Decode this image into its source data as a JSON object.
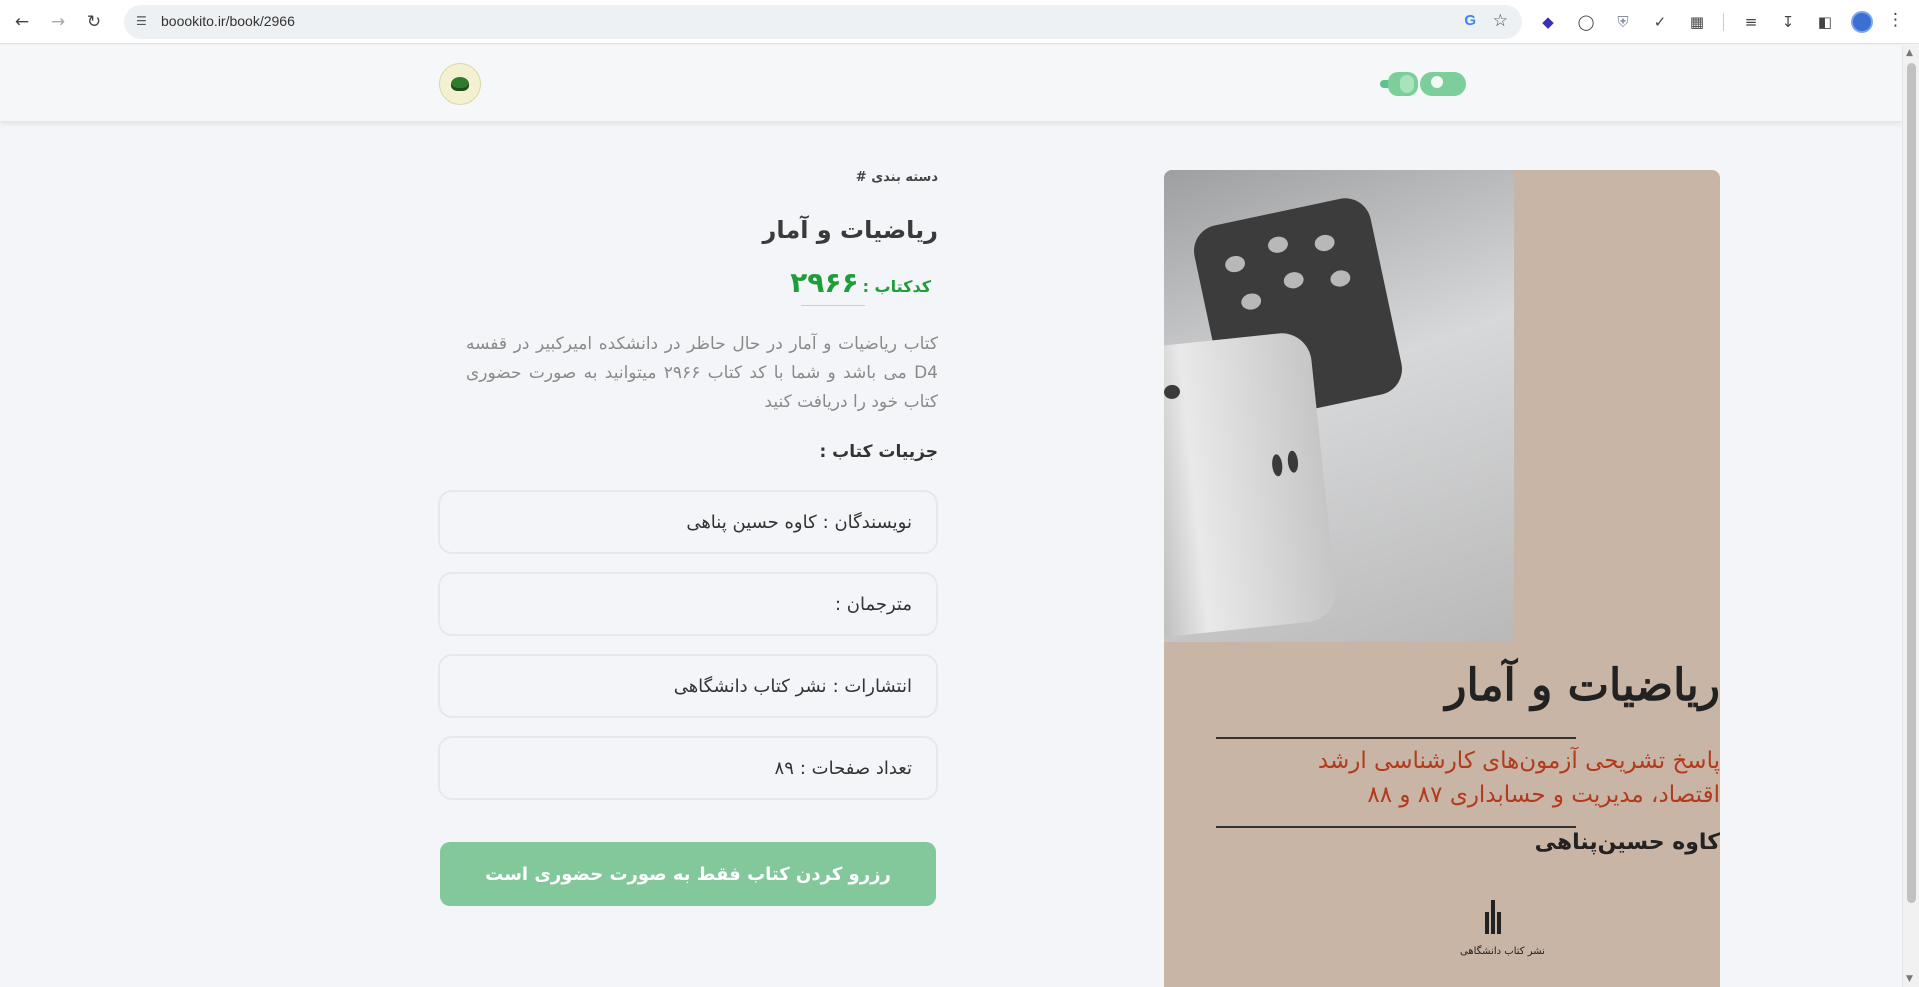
{
  "browser": {
    "url": "boookito.ir/book/2966"
  },
  "book": {
    "category_label": "دسته بندی #",
    "title": "ریاضیات و آمار",
    "code_label": "کدکتاب :",
    "code_value": "۲۹۶۶",
    "description": "کتاب ریاضیات و آمار در حال حاظر در دانشکده امیرکبیر در قفسه D4 می باشد و شما با کد کتاب ۲۹۶۶ میتوانید به صورت حضوری کتاب خود را دریافت کنید",
    "details_title": "جزییات کتاب :",
    "details": [
      {
        "label": "نویسندگان :",
        "value": "کاوه حسین پناهی"
      },
      {
        "label": "مترجمان :",
        "value": ""
      },
      {
        "label": "انتشارات :",
        "value": "نشر کتاب دانشگاهی"
      },
      {
        "label": "تعداد صفحات :",
        "value": "۸۹"
      }
    ],
    "reserve_button": "رزرو کردن کتاب فقط به صورت حضوری است"
  },
  "cover": {
    "title": "ریاضیات و آمار",
    "subtitle_line1": "پاسخ تشریحی آزمون‌های کارشناسی ارشد",
    "subtitle_line2": "اقتصاد، مدیریت و حسابداری ۸۷ و ۸۸",
    "author": "کاوه حسین‌پناهی",
    "publisher": "نشر کتاب دانشگاهی"
  },
  "colors": {
    "accent_green": "#1f9d3a",
    "button_green": "#82c89b",
    "logo_green": "#7ccf9a"
  },
  "icons": {
    "back": "arrow-left-icon",
    "forward": "arrow-right-icon",
    "reload": "reload-icon",
    "site_info": "tune-icon",
    "google": "google-icon",
    "bookmark": "star-icon",
    "extensions": "puzzle-icon",
    "downloads": "download-icon",
    "menu": "kebab-menu-icon"
  }
}
